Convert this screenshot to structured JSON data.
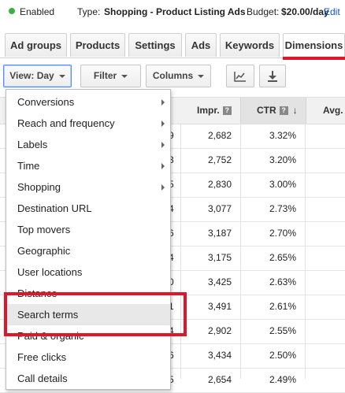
{
  "status": {
    "enabled_label": "Enabled",
    "type_label": "Type:",
    "type_value": "Shopping - Product Listing Ads",
    "budget_label": "Budget:",
    "budget_value": "$20.00/day",
    "edit_link": "Edit",
    "status_color": "#3cb043"
  },
  "tabs": [
    {
      "label": "Ad groups"
    },
    {
      "label": "Products"
    },
    {
      "label": "Settings"
    },
    {
      "label": "Ads"
    },
    {
      "label": "Keywords"
    },
    {
      "label": "Dimensions"
    }
  ],
  "toolbar": {
    "view_label": "View: Day",
    "filter_label": "Filter",
    "columns_label": "Columns",
    "chart_icon": "line-chart-icon",
    "download_icon": "download-icon"
  },
  "table": {
    "headers": {
      "impr": "Impr.",
      "ctr": "CTR",
      "avg": "Avg."
    },
    "rows": [
      {
        "clip": "9",
        "impr": "2,682",
        "ctr": "3.32%"
      },
      {
        "clip": "3",
        "impr": "2,752",
        "ctr": "3.20%"
      },
      {
        "clip": "5",
        "impr": "2,830",
        "ctr": "3.00%"
      },
      {
        "clip": "4",
        "impr": "3,077",
        "ctr": "2.73%"
      },
      {
        "clip": "6",
        "impr": "3,187",
        "ctr": "2.70%"
      },
      {
        "clip": "4",
        "impr": "3,175",
        "ctr": "2.65%"
      },
      {
        "clip": "0",
        "impr": "3,425",
        "ctr": "2.63%"
      },
      {
        "clip": "1",
        "impr": "3,491",
        "ctr": "2.61%"
      },
      {
        "clip": "4",
        "impr": "2,902",
        "ctr": "2.55%"
      },
      {
        "clip": "6",
        "impr": "3,434",
        "ctr": "2.50%"
      },
      {
        "clip": "5",
        "impr": "2,654",
        "ctr": "2.49%"
      }
    ]
  },
  "menu": {
    "items": [
      {
        "label": "Conversions",
        "submenu": true
      },
      {
        "label": "Reach and frequency",
        "submenu": true
      },
      {
        "label": "Labels",
        "submenu": true
      },
      {
        "label": "Time",
        "submenu": true
      },
      {
        "label": "Shopping",
        "submenu": true
      },
      {
        "label": "Destination URL",
        "submenu": false
      },
      {
        "label": "Top movers",
        "submenu": false
      },
      {
        "label": "Geographic",
        "submenu": false
      },
      {
        "label": "User locations",
        "submenu": false
      },
      {
        "label": "Distance",
        "submenu": false
      },
      {
        "label": "Search terms",
        "submenu": false
      },
      {
        "label": "Paid & organic",
        "submenu": false
      },
      {
        "label": "Free clicks",
        "submenu": false
      },
      {
        "label": "Call details",
        "submenu": false
      }
    ],
    "highlighted": "Search terms",
    "highlight_outline_color": "#e0162b"
  }
}
